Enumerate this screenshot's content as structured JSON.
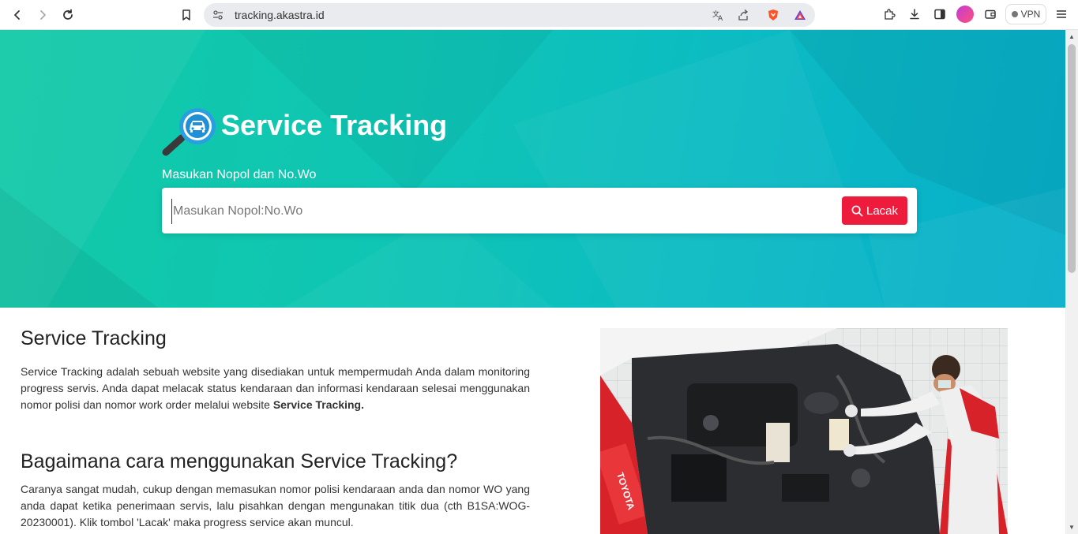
{
  "browser": {
    "url": "tracking.akastra.id",
    "vpn_label": "VPN"
  },
  "hero": {
    "title": "Service Tracking",
    "input_label": "Masukan Nopol dan No.Wo",
    "search_placeholder": "Masukan Nopol:No.Wo",
    "search_button": "Lacak"
  },
  "about": {
    "heading": "Service Tracking",
    "body": "Service Tracking adalah sebuah website yang disediakan untuk mempermudah Anda dalam monitoring progress servis. Anda dapat melacak status kendaraan dan informasi kendaraan selesai menggunakan nomor polisi dan nomor work order melalui website ",
    "body_bold": "Service Tracking."
  },
  "howto": {
    "heading": "Bagaimana cara menggunakan Service Tracking?",
    "body": "Caranya sangat mudah, cukup dengan memasukan nomor polisi kendaraan anda dan nomor WO yang anda dapat ketika penerimaan servis, lalu pisahkan dengan mengunakan titik dua (cth B1SA:WOG-20230001). Klik tombol 'Lacak' maka progress service akan muncul."
  },
  "photo": {
    "banner_text": "TOYOTA"
  },
  "colors": {
    "accent_red": "#ee1c3c",
    "hero_start": "#12c9a6",
    "hero_end": "#07aecb"
  }
}
